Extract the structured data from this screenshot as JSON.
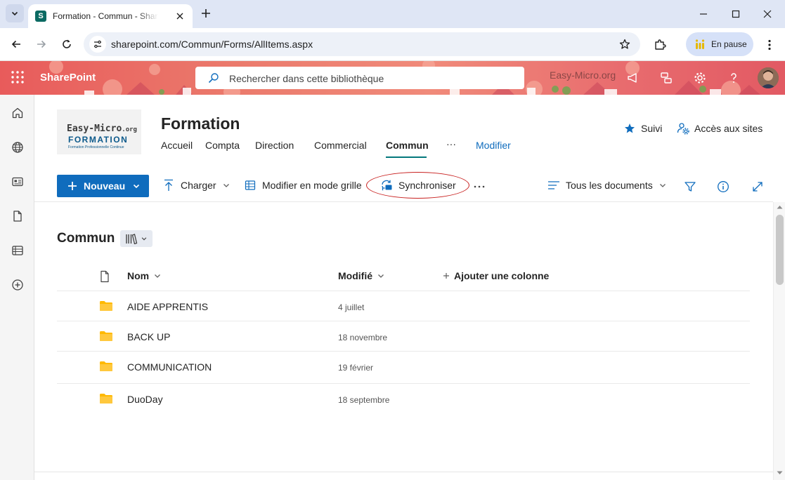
{
  "browser": {
    "tab_title": "Formation - Commun - SharePoint",
    "url": "sharepoint.com/Commun/Forms/AllItems.aspx",
    "profile_status": "En pause",
    "icons": [
      "tab-search-icon",
      "sharepoint-favicon",
      "close-icon",
      "new-tab-icon",
      "minimize-icon",
      "maximize-icon",
      "window-close-icon",
      "back-icon",
      "forward-icon",
      "reload-icon",
      "site-info-icon",
      "bookmark-star-icon",
      "extensions-icon",
      "profile-icon",
      "more-icon"
    ]
  },
  "suitebar": {
    "app_name": "SharePoint",
    "search_placeholder": "Rechercher dans cette bibliothèque",
    "org_name": "Easy-Micro.org",
    "accent": "#e86b6e"
  },
  "appbar": {
    "items": [
      "home-icon",
      "globe-icon",
      "news-icon",
      "file-icon",
      "list-icon",
      "create-icon"
    ]
  },
  "site": {
    "logo_line1": "Easy-Micro",
    "logo_line1_suffix": ".org",
    "logo_line2": "FORMATION",
    "logo_line3": "Formation Professionnelle Continue",
    "title": "Formation",
    "nav": [
      "Accueil",
      "Compta",
      "Direction",
      "Commercial",
      "Commun"
    ],
    "nav_more": "···",
    "nav_edit": "Modifier",
    "follow_label": "Suivi",
    "sites_access_label": "Accès aux sites"
  },
  "commandbar": {
    "new_label": "Nouveau",
    "upload_label": "Charger",
    "grid_label": "Modifier en mode grille",
    "sync_label": "Synchroniser",
    "more_label": "···",
    "view_label": "Tous les documents",
    "brand_color": "#0f6cbd",
    "highlight_color": "#c8201f"
  },
  "library": {
    "title": "Commun",
    "columns": {
      "name": "Nom",
      "modified": "Modifié",
      "add": "Ajouter une colonne"
    },
    "rows": [
      {
        "name": "AIDE APPRENTIS",
        "modified": "4 juillet"
      },
      {
        "name": "BACK UP",
        "modified": "18 novembre"
      },
      {
        "name": "COMMUNICATION",
        "modified": "19 février"
      },
      {
        "name": "DuoDay",
        "modified": "18 septembre"
      }
    ]
  }
}
